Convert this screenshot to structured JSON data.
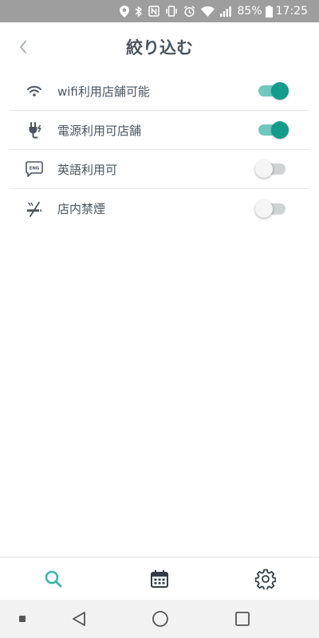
{
  "status_bar": {
    "battery_percent": "85%",
    "time": "17:25",
    "icons": [
      "location-icon",
      "bluetooth-icon",
      "nfc-icon",
      "vibrate-icon",
      "alarm-icon",
      "wifi-icon",
      "signal-icon",
      "battery-icon"
    ]
  },
  "header": {
    "title": "絞り込む",
    "back_icon": "chevron-left-icon"
  },
  "filters": [
    {
      "label": "wifi利用店舗可能",
      "icon": "wifi-icon",
      "enabled": true
    },
    {
      "label": "電源利用可店舗",
      "icon": "power-plug-icon",
      "enabled": true
    },
    {
      "label": "英語利用可",
      "icon": "eng-chat-icon",
      "enabled": false
    },
    {
      "label": "店内禁煙",
      "icon": "no-smoking-icon",
      "enabled": false
    }
  ],
  "tabs": [
    {
      "icon": "search-icon",
      "active": true
    },
    {
      "icon": "calendar-icon",
      "active": false
    },
    {
      "icon": "gear-icon",
      "active": false
    }
  ],
  "colors": {
    "accent": "#159b8c",
    "accent_track": "#6fc8bd",
    "active_tab": "#3bb5ad",
    "text": "#4a5560",
    "status_bar": "#9e9e9e"
  },
  "nav_bar": {
    "buttons": [
      "dot-icon",
      "back-triangle-icon",
      "home-circle-icon",
      "recents-square-icon"
    ]
  }
}
